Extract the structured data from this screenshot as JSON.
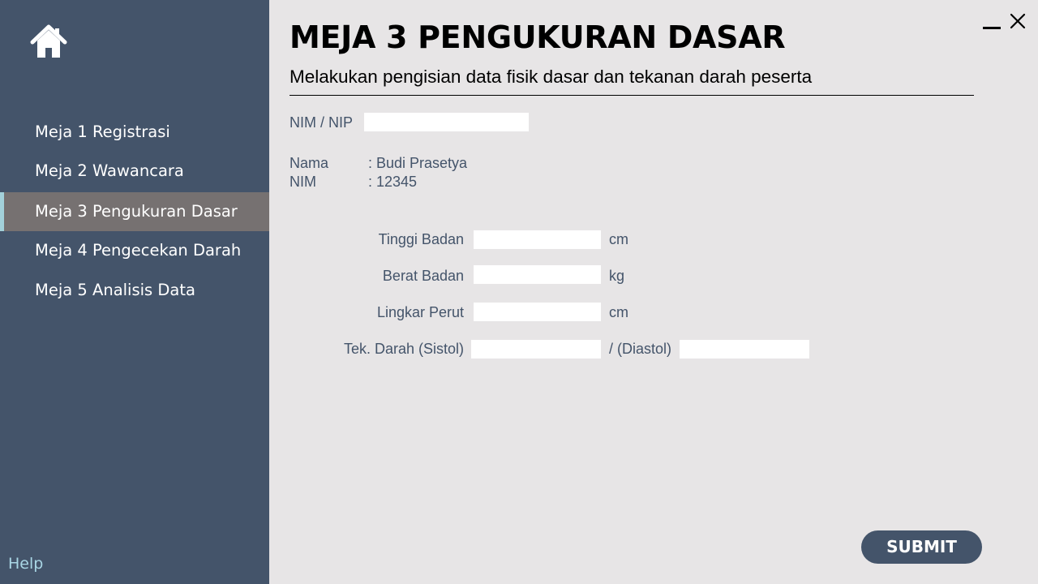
{
  "sidebar": {
    "home_icon": "home-icon",
    "items": [
      {
        "label": "Meja 1 Registrasi"
      },
      {
        "label": "Meja 2 Wawancara"
      },
      {
        "label": "Meja 3 Pengukuran Dasar",
        "active": true
      },
      {
        "label": "Meja 4 Pengecekan Darah"
      },
      {
        "label": "Meja 5 Analisis Data"
      }
    ],
    "help_label": "Help"
  },
  "window": {
    "minimize_icon": "minimize-icon",
    "close_icon": "close-icon"
  },
  "header": {
    "title": "MEJA 3 PENGUKURAN DASAR",
    "subtitle": "Melakukan pengisian data fisik dasar dan tekanan darah peserta"
  },
  "form": {
    "nim_nip_label": "NIM / NIP",
    "nim_nip_value": "",
    "nama_label": "Nama",
    "nama_value": ": Budi Prasetya",
    "nim_label": "NIM",
    "nim_value": ": 12345",
    "tinggi_label": "Tinggi Badan",
    "tinggi_unit": "cm",
    "berat_label": "Berat Badan",
    "berat_unit": "kg",
    "lingkar_label": "Lingkar Perut",
    "lingkar_unit": "cm",
    "sistol_label": "Tek. Darah (Sistol)",
    "diastol_label": "/ (Diastol)"
  },
  "submit_label": "SUBMIT",
  "colors": {
    "sidebar_bg": "#44546a",
    "active_item_bg": "#767171",
    "active_indicator": "#a3d1da",
    "main_bg": "#e7e5e6",
    "label_text": "#44546a",
    "help_text": "#a9d6e5"
  }
}
